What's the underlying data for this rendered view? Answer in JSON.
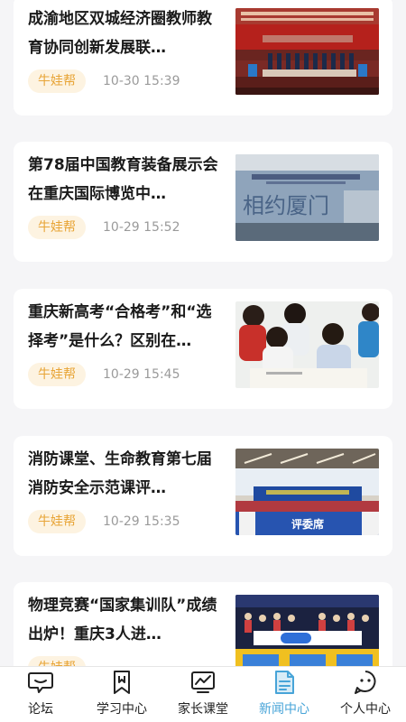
{
  "news": [
    {
      "title": "成渝地区双城经济圈教师教育协同创新发展联…",
      "tag": "牛娃帮",
      "time": "10-30 15:39",
      "image": "stage-ceremony"
    },
    {
      "title": "第78届中国教育装备展示会在重庆国际博览中…",
      "tag": "牛娃帮",
      "time": "10-29 15:52",
      "image": "expo-banner"
    },
    {
      "title": "重庆新高考“合格考”和“选择考”是什么？区别在…",
      "tag": "牛娃帮",
      "time": "10-29 15:45",
      "image": "students-group"
    },
    {
      "title": "消防课堂、生命教育第七届消防安全示范课评…",
      "tag": "牛娃帮",
      "time": "10-29 15:35",
      "image": "judges-table"
    },
    {
      "title": "物理竞赛“国家集训队”成绩出炉！重庆3人进…",
      "tag": "牛娃帮",
      "time": "",
      "image": "competition-stage"
    }
  ],
  "thumb_text": {
    "expo_banner": "相约厦门",
    "judges_sign": "评委席"
  },
  "tabbar": {
    "items": [
      {
        "label": "论坛",
        "icon": "chat-icon"
      },
      {
        "label": "学习中心",
        "icon": "bookmark-book-icon"
      },
      {
        "label": "家长课堂",
        "icon": "chart-board-icon"
      },
      {
        "label": "新闻中心",
        "icon": "news-document-icon"
      },
      {
        "label": "个人中心",
        "icon": "user-face-icon"
      }
    ],
    "active_index": 3
  },
  "colors": {
    "accent": "#47a4d8",
    "tag_text": "#e8a538",
    "tag_bg": "#fdf3e1"
  }
}
